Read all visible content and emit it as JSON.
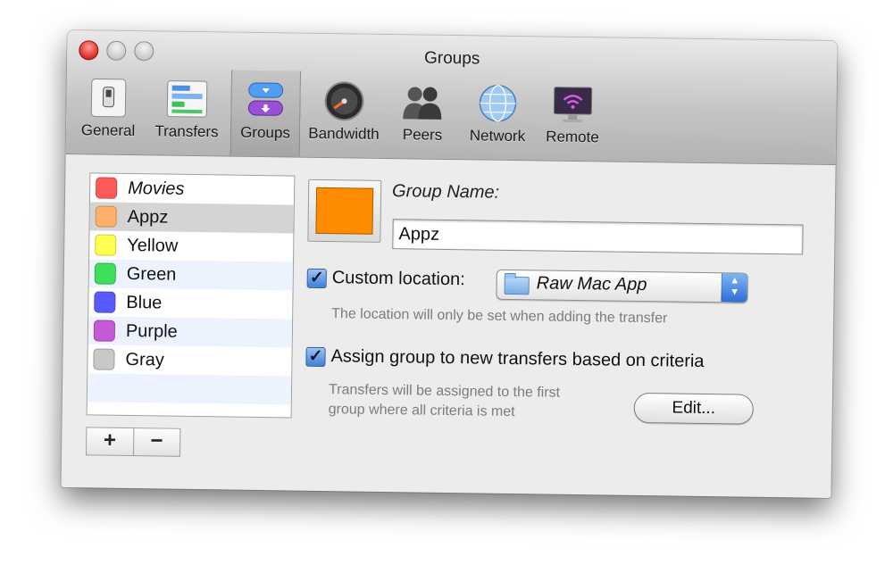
{
  "window": {
    "title": "Groups"
  },
  "toolbar": {
    "items": [
      {
        "label": "General",
        "icon": "general-switch-icon"
      },
      {
        "label": "Transfers",
        "icon": "transfers-icon"
      },
      {
        "label": "Groups",
        "icon": "groups-icon",
        "selected": true
      },
      {
        "label": "Bandwidth",
        "icon": "bandwidth-gauge-icon"
      },
      {
        "label": "Peers",
        "icon": "peers-icon"
      },
      {
        "label": "Network",
        "icon": "network-globe-icon"
      },
      {
        "label": "Remote",
        "icon": "remote-monitor-icon"
      }
    ]
  },
  "groups": {
    "items": [
      {
        "label": "Movies",
        "color": "#ff5a5a",
        "italic": true
      },
      {
        "label": "Appz",
        "color": "#ffb06a",
        "selected": true
      },
      {
        "label": "Yellow",
        "color": "#ffff52"
      },
      {
        "label": "Green",
        "color": "#3de05a"
      },
      {
        "label": "Blue",
        "color": "#5a5aff"
      },
      {
        "label": "Purple",
        "color": "#c45ad6"
      },
      {
        "label": "Gray",
        "color": "#c8c8c8"
      }
    ],
    "add_label": "+",
    "remove_label": "−"
  },
  "detail": {
    "color": "#ff8c00",
    "group_name_label": "Group Name:",
    "group_name_value": "Appz",
    "custom_location_label": "Custom location:",
    "custom_location_checked": true,
    "location_value": "Raw Mac App",
    "location_hint": "The location will only be set when adding the transfer",
    "assign_label": "Assign group to new transfers based on criteria",
    "assign_checked": true,
    "assign_hint_line1": "Transfers will be assigned to the first",
    "assign_hint_line2": "group where all criteria is met",
    "edit_label": "Edit..."
  },
  "colors": {
    "accent": "#3d7fd8",
    "window_bg": "#ececec"
  }
}
